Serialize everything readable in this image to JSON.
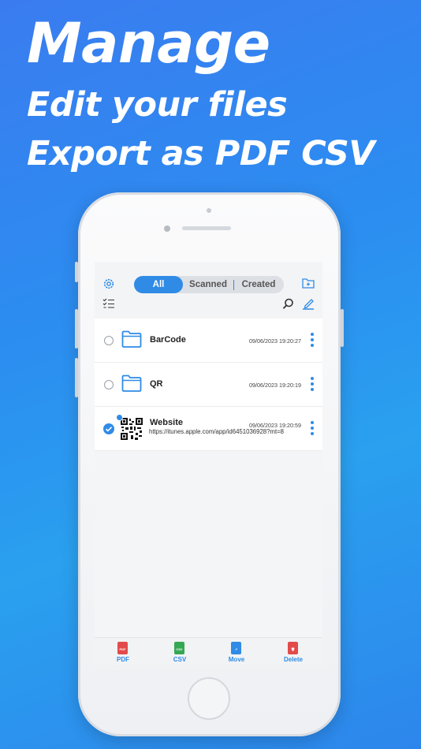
{
  "headline": {
    "line1": "Manage",
    "line2": "Edit your files",
    "line3": "Export as PDF CSV"
  },
  "tabs": [
    {
      "label": "All",
      "active": true
    },
    {
      "label": "Scanned",
      "active": false
    },
    {
      "label": "Created",
      "active": false
    }
  ],
  "icons": {
    "settings": "gear-icon",
    "new_folder": "new-folder-icon",
    "select": "checklist-icon",
    "search": "search-icon",
    "edit": "edit-icon"
  },
  "items": [
    {
      "name": "BarCode",
      "date": "09/06/2023 19:20:27",
      "type": "folder",
      "selected": false
    },
    {
      "name": "QR",
      "date": "09/06/2023 19:20:19",
      "type": "folder",
      "selected": false
    },
    {
      "name": "Website",
      "date": "09/06/2023 19:20:59",
      "type": "qr",
      "selected": true,
      "url": "https://itunes.apple.com/app/id6451036928?mt=8"
    }
  ],
  "toolbar": {
    "pdf": "PDF",
    "csv": "CSV",
    "move": "Move",
    "delete": "Delete"
  },
  "colors": {
    "accent": "#2f8be6",
    "pdf": "#e24b4b",
    "csv": "#35a853",
    "move": "#2f8be6",
    "delete": "#e24b4b"
  }
}
